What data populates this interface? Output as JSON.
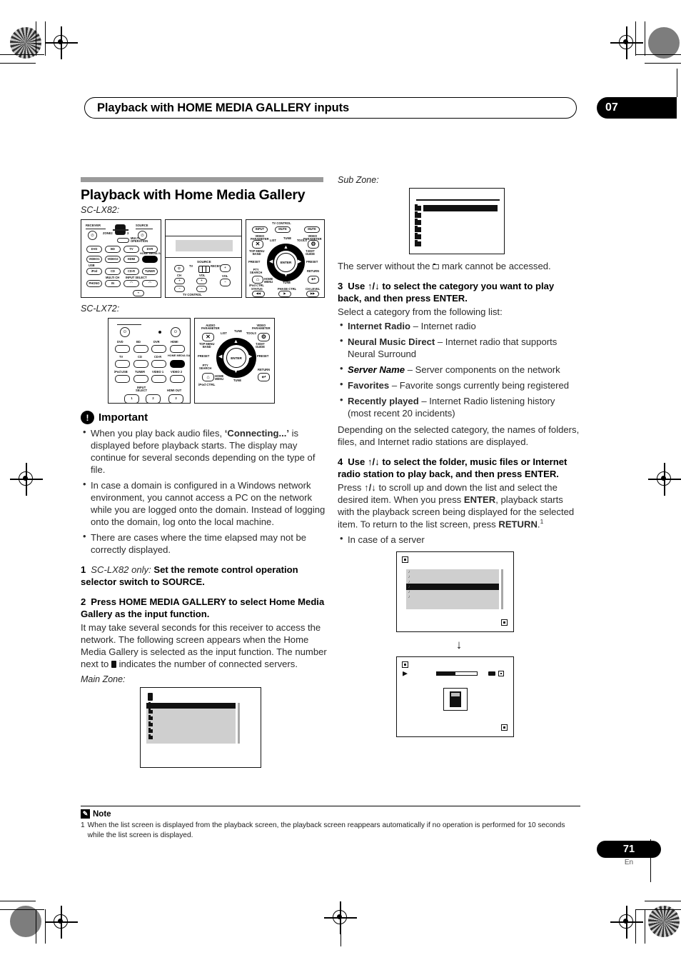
{
  "header": {
    "title": "Playback with HOME MEDIA GALLERY inputs",
    "chapter": "07"
  },
  "section": {
    "title": "Playback with Home Media Gallery",
    "model_lx82": "SC-LX82:",
    "model_lx72": "SC-LX72:"
  },
  "remote_lx82": {
    "panel1": {
      "receiver_label": "RECEIVER",
      "source_label": "SOURCE",
      "zone_label": "ZONE2",
      "zone_num": "3",
      "multi_operation": "MULTI\nOPERATION",
      "usb_label": "USB",
      "multi_ch": "MULTI CH",
      "input_select": "INPUT SELECT",
      "buttons": [
        "DVD",
        "BD",
        "TV",
        "DVR",
        "VIDEO1",
        "VIDEO2",
        "HDMI",
        "HOME MEDIA GALLERY",
        "iPod",
        "CD",
        "CD-R",
        "TUNER",
        "PHONO",
        "IN"
      ],
      "highlight": "HOME MEDIA GALLERY"
    },
    "panel2": {
      "source_label": "SOURCE",
      "tv_label": "TV",
      "receiver_label": "RECEIVER",
      "ch_label": "CH",
      "vol_label": "VOL",
      "vol_side": "VOL",
      "tv_control": "TV CONTROL"
    },
    "panel3": {
      "tv_control": "TV CONTROL",
      "input": "INPUT",
      "mute": "MUTE",
      "mute2": "MUTE",
      "video_parameter_l": "VIDEO\nPARAMETER",
      "video_parameter_r": "VIDEO\nPARAMETER",
      "list": "LIST",
      "tune": "TUNE",
      "tools": "TOOLS",
      "top_menu_band": "TOP MENU\nBAND",
      "tedit_guide": "T.EDIT\nGUIDE",
      "preset_l": "PRESET",
      "preset_r": "PRESET",
      "enter": "ENTER",
      "pty_search": "PTY\nSEARCH",
      "return": "RETURN",
      "home_menu": "HOME\nMENU",
      "tune_bottom": "TUNE",
      "ipod_ctrl": "iPod CTRL",
      "status": "STATUS",
      "phase_ctrl": "PHASE CTRL",
      "ch_level": "CH LEVEL"
    }
  },
  "remote_lx72": {
    "panel1": {
      "buttons": [
        "DVD",
        "BD",
        "DVR",
        "HDMI",
        "TV",
        "CD",
        "CD-R",
        "HOME MEDIA GALLERY",
        "iPod USB",
        "TUNER",
        "VIDEO 1",
        "VIDEO 2",
        "1",
        "2",
        "3"
      ],
      "highlight": "HOME MEDIA GALLERY",
      "input_select": "INPUT\nSELECT",
      "hdmi_out": "HDMI OUT"
    },
    "panel2": {
      "audio_parameter": "AUDIO\nPARAMETER",
      "video_parameter": "VIDEO\nPARAMETER",
      "list": "LIST",
      "tune": "TUNE",
      "tools": "TOOLS",
      "top_menu_band": "TOP MENU\nBAND",
      "tedit_guide": "T.EDIT\nGUIDE",
      "preset_l": "PRESET",
      "preset_r": "PRESET",
      "enter": "ENTER",
      "pty_search": "PTY\nSEARCH",
      "return": "RETURN",
      "home_menu": "HOME\nMENU",
      "tune_bottom": "TUNE",
      "ipod_ctrl": "iPod CTRL"
    }
  },
  "important": {
    "title": "Important",
    "bullets": [
      {
        "pre": "When you play back audio files, ",
        "bold": "‘Connecting...’",
        "post": " is displayed before playback starts. The display may continue for several seconds depending on the type of file."
      },
      {
        "pre": "In case a domain is configured in a Windows network environment, you cannot access a PC on the network while you are logged onto the domain. Instead of logging onto the domain, log onto the local machine.",
        "bold": "",
        "post": ""
      },
      {
        "pre": "There are cases where the time elapsed may not be correctly displayed.",
        "bold": "",
        "post": ""
      }
    ]
  },
  "steps": {
    "step1": {
      "num": "1",
      "italic_prefix": "SC-LX82 only:",
      "bold": "Set the remote control operation selector switch to SOURCE."
    },
    "step2": {
      "num": "2",
      "bold": "Press HOME MEDIA GALLERY to select Home Media Gallery as the input function.",
      "body_a": "It may take several seconds for this receiver to access the network. The following screen appears when the Home Media Gallery is selected as the input function. The number next to ",
      "body_b": " indicates the number of connected servers."
    },
    "step3": {
      "num": "3",
      "bold_a": "Use ",
      "arrows": "↑/↓",
      "bold_b": " to select the category you want to play back, and then press ENTER.",
      "body": "Select a category from the following list:",
      "categories": [
        {
          "name": "Internet Radio",
          "style": "bold",
          "desc": " – Internet radio"
        },
        {
          "name": "Neural Music Direct",
          "style": "bold",
          "desc": " – Internet radio that supports Neural Surround"
        },
        {
          "name": "Server Name",
          "style": "bold-italic",
          "desc": " – Server components on the network"
        },
        {
          "name": "Favorites",
          "style": "bold",
          "desc": " – Favorite songs currently being registered"
        },
        {
          "name": "Recently played",
          "style": "bold",
          "desc": " – Internet Radio listening history (most recent 20 incidents)"
        }
      ],
      "after": "Depending on the selected category, the names of folders, files, and Internet radio stations are displayed."
    },
    "step4": {
      "num": "4",
      "bold_a": "Use ",
      "arrows": "↑/↓",
      "bold_b": " to select the folder, music files or Internet radio station to play back, and then press ENTER.",
      "body_a": "Press ",
      "body_arrows": "↑/↓",
      "body_b": " to scroll up and down the list and select the desired item. When you press ",
      "enter_bold": "ENTER",
      "body_c": ", playback starts with the playback screen being displayed for the selected item. To return to the list screen, press ",
      "return_bold": "RETURN",
      "footnote_ref": "1",
      "sub_bullet": "In case of a server"
    }
  },
  "right_col": {
    "sub_zone_caption": "Sub Zone:",
    "server_mark_text_a": "The server without the ",
    "server_mark_text_b": " mark cannot be accessed.",
    "arrow_between_screens": "↓"
  },
  "main_zone_caption": "Main Zone:",
  "note": {
    "title": "Note",
    "items": [
      {
        "num": "1",
        "text": "When the list screen is displayed from the playback screen, the playback screen reappears automatically if no operation is performed for 10 seconds while the list screen is displayed."
      }
    ]
  },
  "footer": {
    "page": "71",
    "lang": "En"
  }
}
